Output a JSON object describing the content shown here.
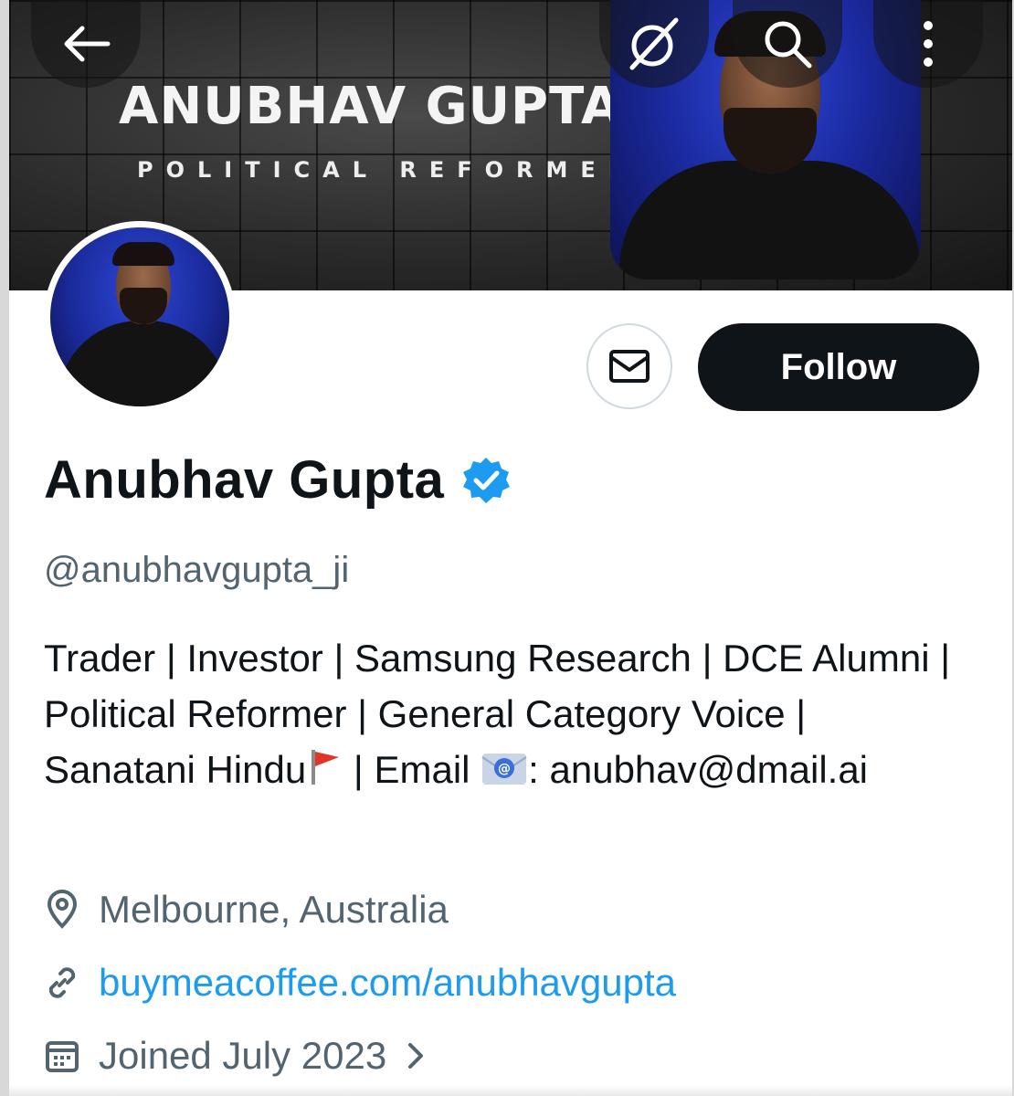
{
  "banner": {
    "title": "ANUBHAV GUPTA",
    "subtitle": "POLITICAL REFORMER"
  },
  "top_bar": {
    "icons": [
      "back-arrow-icon",
      "grok-icon",
      "search-icon",
      "more-vertical-icon"
    ]
  },
  "actions": {
    "message_icon": "envelope-icon",
    "follow_label": "Follow"
  },
  "profile": {
    "display_name": "Anubhav Gupta",
    "verified_icon": "verified-badge-icon",
    "handle": "@anubhavgupta_ji",
    "bio": {
      "part1": "Trader | Investor | Samsung Research | DCE Alumni | Political Reformer | General Category Voice | Sanatani Hindu",
      "part2": " | Email ",
      "part3": ": anubhav@dmail.ai"
    },
    "location": "Melbourne, Australia",
    "website": "buymeacoffee.com/anubhavgupta",
    "joined": "Joined July 2023"
  },
  "colors": {
    "follow_bg": "#0f1419",
    "link": "#1d9bf0",
    "muted": "#536471",
    "verified": "#1d9bf0"
  }
}
